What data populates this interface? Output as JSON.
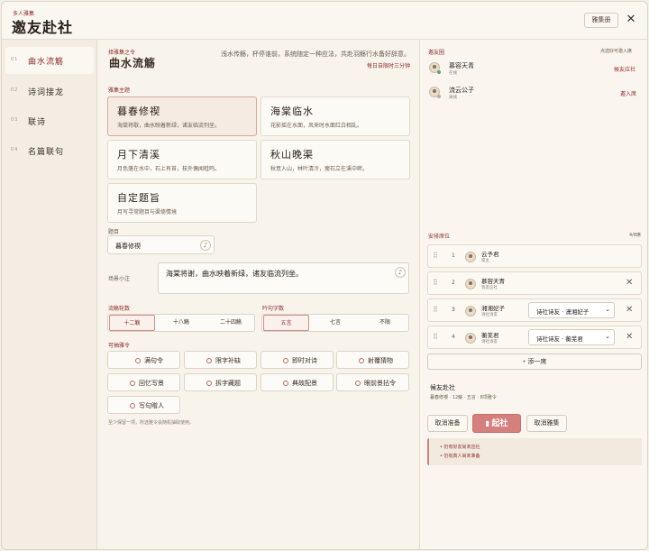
{
  "header": {
    "subtitle": "多人雅集",
    "title": "邀友赴社",
    "history_label": "雅集册",
    "close_icon": "close-icon"
  },
  "sidebar": {
    "items": [
      {
        "num": "01",
        "label": "曲水流觞",
        "active": true
      },
      {
        "num": "02",
        "label": "诗词接龙",
        "active": false
      },
      {
        "num": "03",
        "label": "联诗",
        "active": false
      },
      {
        "num": "04",
        "label": "名篇联句",
        "active": false
      }
    ]
  },
  "mode": {
    "tag": "择雅集之令",
    "title": "曲水流觞",
    "desc": "浅水传觞，杯停谁前，系统随定一种应法，共赴羽觞行水备好辞意。",
    "time": "每日自限时三分钟"
  },
  "theme": {
    "label": "雅集主题",
    "cards": [
      {
        "title": "暮春修禊",
        "desc": "海棠将歇，曲水映着新绿，诸友临流列坐。",
        "selected": true
      },
      {
        "title": "海棠临水",
        "desc": "花影摇在水面，风来时水面红白相乱。",
        "selected": false
      },
      {
        "title": "月下清溪",
        "desc": "月色落在水中，石上有苔，枝外偶闻蛙鸣。",
        "selected": false
      },
      {
        "title": "秋山晚渠",
        "desc": "秋意入山，林叶清冷，瘦石立在溪中畔。",
        "selected": false
      },
      {
        "title": "自定题旨",
        "desc": "月写寻常题目与渠倚情境",
        "selected": false
      }
    ]
  },
  "title_field": {
    "label": "题目",
    "value": "暮春修禊"
  },
  "scene_field": {
    "label": "场景小注",
    "value": "海棠将谢，曲水映着新绿，诸友临流列坐。"
  },
  "rounds": {
    "label": "流觞轮数",
    "options": [
      "十二觞",
      "十八觞",
      "二十四觞"
    ],
    "selected": 0
  },
  "chars": {
    "label": "吟句字数",
    "options": [
      "五言",
      "七言",
      "不限"
    ],
    "selected": 0
  },
  "orders": {
    "label": "可抽雅令",
    "items": [
      "满句令",
      "限字补缺",
      "即时对诗",
      "射覆猜物",
      "回忆写景",
      "拆字藏题",
      "典故配景",
      "眼前景拈令",
      "写句贈人"
    ],
    "hint": "至少保留一项，所选雅令会随机抽取使用。"
  },
  "friends": {
    "label": "邀友圈",
    "note": "点选好可邀入席",
    "list": [
      {
        "name": "慕容天青",
        "status": "在线",
        "status_color": "#6aa36b",
        "action": "候友应社"
      },
      {
        "name": "流云公子",
        "status": "离线",
        "status_color": "#b8ad9f",
        "action": "邀入席"
      }
    ]
  },
  "seats": {
    "label": "安排席位",
    "count": "4/8席",
    "rows": [
      {
        "num": "1",
        "name": "云予君",
        "role": "席主",
        "has_select": false,
        "removable": false
      },
      {
        "num": "2",
        "name": "慕容天青",
        "role": "等友应社",
        "has_select": false,
        "removable": true
      },
      {
        "num": "3",
        "name": "湘湘妃子",
        "role": "诗社诗友",
        "has_select": true,
        "select_value": "诗社诗友 · 潇湘妃子",
        "removable": true
      },
      {
        "num": "4",
        "name": "蘅芜君",
        "role": "诗社诗友",
        "has_select": true,
        "select_value": "诗社诗友 · 蘅芜君",
        "removable": true
      }
    ],
    "add_label": "+ 添一席"
  },
  "summary": {
    "title": "候友赴社",
    "detail": "暮春修禊 · 12觞 · 五言 · 8项雅令"
  },
  "actions": {
    "cancel_label": "取消准备",
    "start_label": "起社",
    "disband_label": "取消雅集"
  },
  "warnings": [
    "仍有好友尚未应社",
    "仍有真人尚未准备"
  ],
  "colors": {
    "accent": "#8b2c2c",
    "primary_button": "#d57f7f",
    "background": "#f8f4ec"
  }
}
